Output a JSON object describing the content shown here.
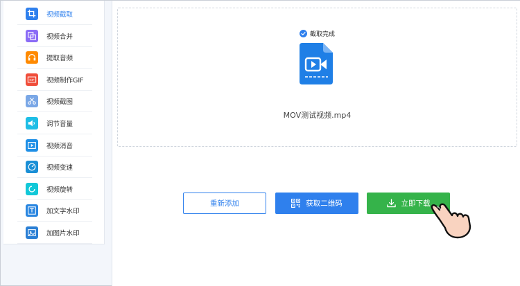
{
  "sidebar": {
    "items": [
      {
        "label": "视频截取",
        "icon": "crop-icon",
        "color": "#2f80ed",
        "active": true
      },
      {
        "label": "视频合并",
        "icon": "merge-icon",
        "color": "#8b6cf6"
      },
      {
        "label": "提取音频",
        "icon": "headphones-icon",
        "color": "#ff8a00"
      },
      {
        "label": "视频制作GIF",
        "icon": "gif-icon",
        "color": "#f04e3b"
      },
      {
        "label": "视频截图",
        "icon": "scissors-icon",
        "color": "#7aa7e6"
      },
      {
        "label": "调节音量",
        "icon": "volume-icon",
        "color": "#1ebee6"
      },
      {
        "label": "视频消音",
        "icon": "video-play-icon",
        "color": "#1f8fe6"
      },
      {
        "label": "视频变速",
        "icon": "speed-icon",
        "color": "#1a8fd6"
      },
      {
        "label": "视频旋转",
        "icon": "rotate-icon",
        "color": "#12c8d8"
      },
      {
        "label": "加文字水印",
        "icon": "text-watermark-icon",
        "color": "#2a86e0"
      },
      {
        "label": "加图片水印",
        "icon": "image-watermark-icon",
        "color": "#2a7fd4"
      }
    ]
  },
  "main": {
    "status_text": "截取完成",
    "file_name": "MOV测试视频.mp4",
    "buttons": {
      "readd": "重新添加",
      "qr": "获取二维码",
      "download": "立即下载"
    }
  },
  "colors": {
    "accent": "#2f80ed",
    "download_green": "#35b34a",
    "active_bg": "#2f80ed"
  }
}
